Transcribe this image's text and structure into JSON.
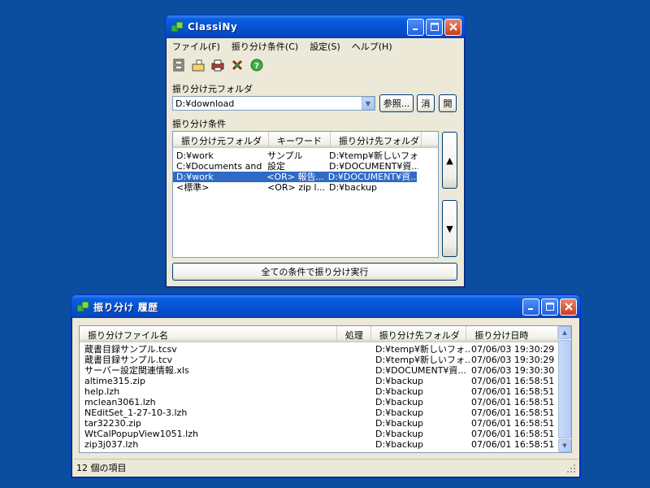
{
  "main_window": {
    "title": "ClassiNy",
    "menu": [
      "ファイル(F)",
      "振り分け条件(C)",
      "設定(S)",
      "ヘルプ(H)"
    ],
    "toolbar_icons": [
      "cabinet-icon",
      "rename-icon",
      "printer-icon",
      "tools-icon",
      "help-icon"
    ],
    "source_label": "振り分け元フォルダ",
    "source_value": "D:¥download",
    "browse_label": "参照...",
    "clear_label": "消",
    "open_label": "開",
    "rules_label": "振り分け条件",
    "rules_columns": [
      "振り分け元フォルダ",
      "キーワード",
      "振り分け先フォルダ"
    ],
    "rules_rows": [
      {
        "src": "D:¥work",
        "kw": "サンプル",
        "dst": "D:¥temp¥新しいフォ...",
        "selected": false
      },
      {
        "src": "C:¥Documents and ...",
        "kw": "設定",
        "dst": "D:¥DOCUMENT¥資...",
        "selected": false
      },
      {
        "src": "D:¥work",
        "kw": "<OR> 報告...",
        "dst": "D:¥DOCUMENT¥資...",
        "selected": true
      },
      {
        "src": "<標準>",
        "kw": "<OR> zip l...",
        "dst": "D:¥backup",
        "selected": false
      }
    ],
    "up_symbol": "▲",
    "down_symbol": "▼",
    "run_all_label": "全ての条件で振り分け実行"
  },
  "history_window": {
    "title": "振り分け 履歴",
    "columns": [
      "振り分けファイル名",
      "処理",
      "振り分け先フォルダ",
      "振り分け日時"
    ],
    "rows": [
      {
        "name": "蔵書目録サンプル.tcsv",
        "op": "",
        "dst": "D:¥temp¥新しいフォ...",
        "time": "07/06/03 19:30:29"
      },
      {
        "name": "蔵書目録サンプル.tcv",
        "op": "",
        "dst": "D:¥temp¥新しいフォ...",
        "time": "07/06/03 19:30:29"
      },
      {
        "name": "サーバー設定関連情報.xls",
        "op": "",
        "dst": "D:¥DOCUMENT¥資...",
        "time": "07/06/03 19:30:30"
      },
      {
        "name": "altime315.zip",
        "op": "",
        "dst": "D:¥backup",
        "time": "07/06/01 16:58:51"
      },
      {
        "name": "help.lzh",
        "op": "",
        "dst": "D:¥backup",
        "time": "07/06/01 16:58:51"
      },
      {
        "name": "mclean3061.lzh",
        "op": "",
        "dst": "D:¥backup",
        "time": "07/06/01 16:58:51"
      },
      {
        "name": "NEditSet_1-27-10-3.lzh",
        "op": "",
        "dst": "D:¥backup",
        "time": "07/06/01 16:58:51"
      },
      {
        "name": "tar32230.zip",
        "op": "",
        "dst": "D:¥backup",
        "time": "07/06/01 16:58:51"
      },
      {
        "name": "WtCalPopupView1051.lzh",
        "op": "",
        "dst": "D:¥backup",
        "time": "07/06/01 16:58:51"
      },
      {
        "name": "zip3j037.lzh",
        "op": "",
        "dst": "D:¥backup",
        "time": "07/06/01 16:58:51"
      }
    ],
    "status": "12 個の項目"
  },
  "colors": {
    "desktop": "#0b4d9e",
    "selection": "#316ac5",
    "window_face": "#ece9d8"
  }
}
